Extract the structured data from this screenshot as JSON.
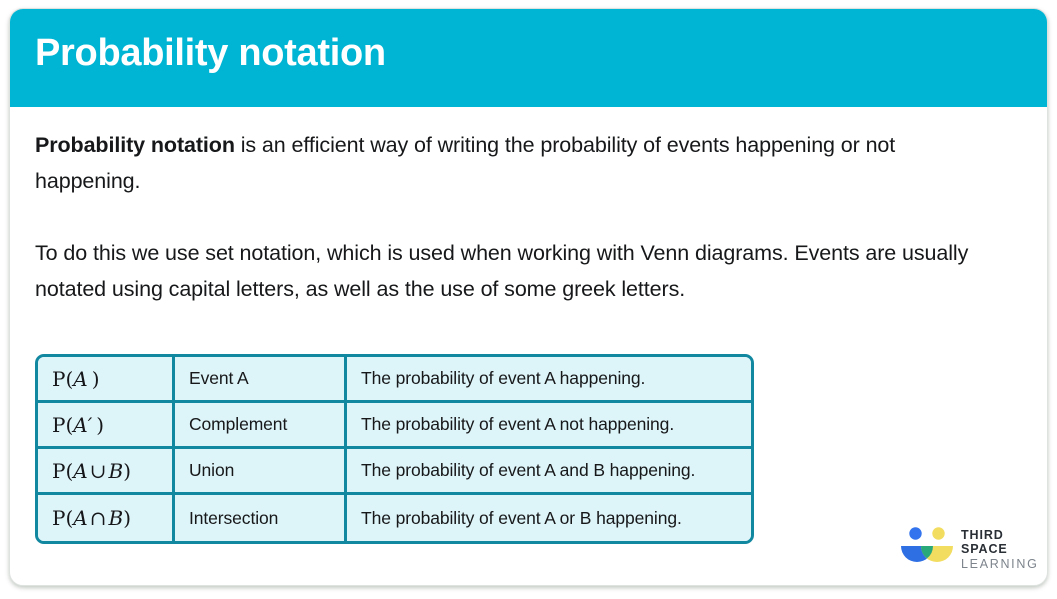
{
  "header": {
    "title": "Probability notation",
    "background_color": "#00b5d4",
    "text_color": "#ffffff"
  },
  "body": {
    "paragraph_1_bold": "Probability notation",
    "paragraph_1_rest": " is an efficient way of writing the probability of events happening or not happening.",
    "paragraph_2": "To do this we use set notation, which is used when working with Venn diagrams. Events are usually notated using capital letters, as well as the use of some greek letters."
  },
  "table": {
    "border_color": "#1287a0",
    "cell_background": "#ddf4f8",
    "rows": [
      {
        "symbol_prefix": "P(",
        "symbol_var_1": "A",
        "symbol_operator": "",
        "symbol_var_2": "",
        "symbol_suffix": ")",
        "symbol_plain": "P(A)",
        "name": "Event A",
        "description": "The probability of event A happening."
      },
      {
        "symbol_prefix": "P(",
        "symbol_var_1": "A′",
        "symbol_operator": "",
        "symbol_var_2": "",
        "symbol_suffix": ")",
        "symbol_plain": "P(A′)",
        "name": "Complement",
        "description": "The probability of event A not happening."
      },
      {
        "symbol_prefix": "P(",
        "symbol_var_1": "A",
        "symbol_operator": "∪",
        "symbol_var_2": "B",
        "symbol_suffix": ")",
        "symbol_plain": "P(A ∪ B)",
        "name": "Union",
        "description": "The probability of event A and B happening."
      },
      {
        "symbol_prefix": "P(",
        "symbol_var_1": "A",
        "symbol_operator": "∩",
        "symbol_var_2": "B",
        "symbol_suffix": ")",
        "symbol_plain": "P(A ∩ B)",
        "name": "Intersection",
        "description": "The probability of event A or B happening."
      }
    ]
  },
  "logo": {
    "line_1": "THIRD SPACE",
    "line_2": "LEARNING",
    "color_blue": "#2f6fe4",
    "color_blue_head": "#3374ee",
    "color_yellow": "#f2dd60",
    "color_green": "#29a87a"
  }
}
